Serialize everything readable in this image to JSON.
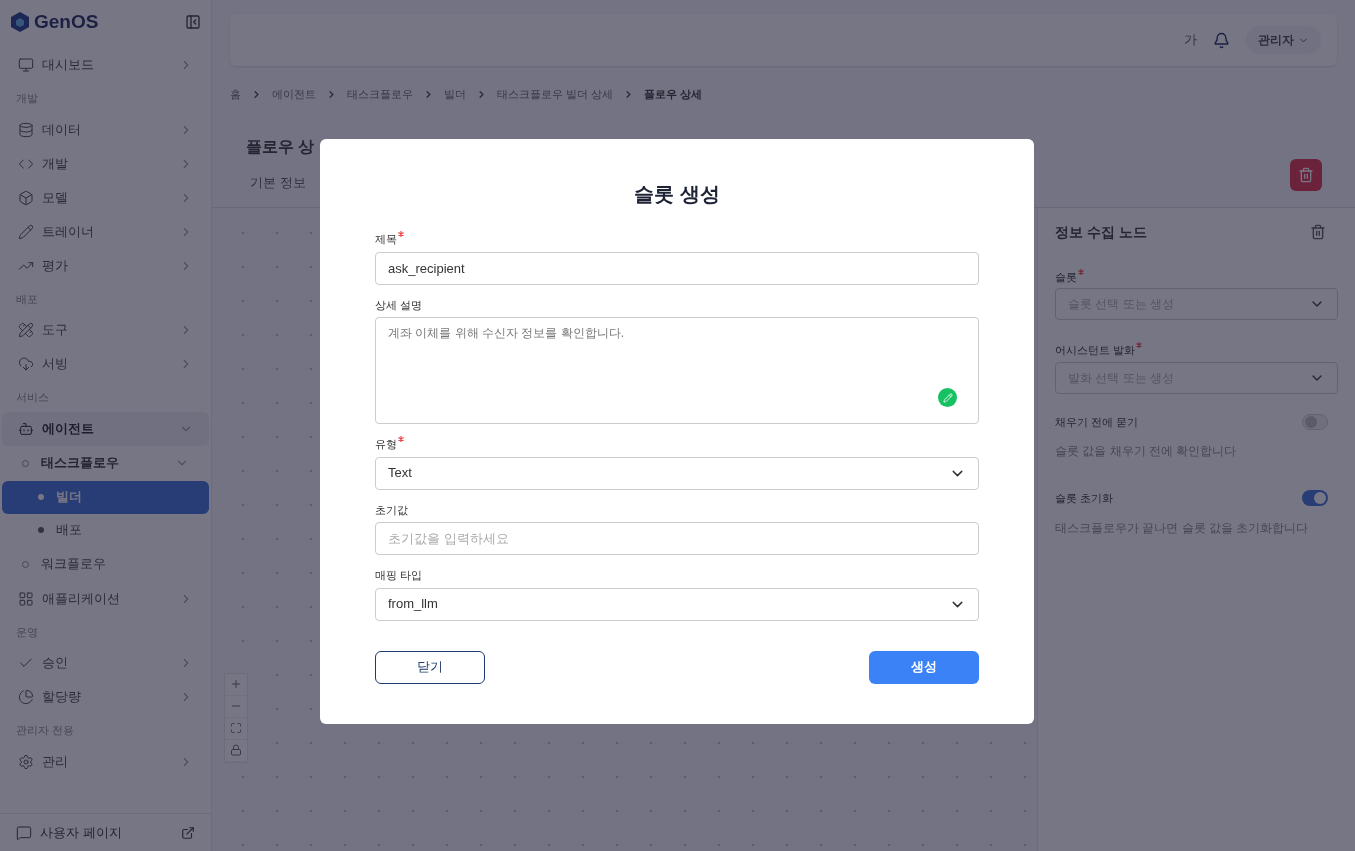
{
  "sidebar": {
    "logo": "GenOS",
    "sections": [
      {
        "items": [
          {
            "label": "대시보드",
            "selected": false,
            "expanded": false
          }
        ]
      },
      {
        "heading": "개발",
        "items": [
          {
            "label": "데이터",
            "selected": false,
            "expanded": false
          },
          {
            "label": "개발",
            "selected": false,
            "expanded": false
          },
          {
            "label": "모델",
            "selected": false,
            "expanded": false
          },
          {
            "label": "트레이너",
            "selected": false,
            "expanded": false
          },
          {
            "label": "평가",
            "selected": false,
            "expanded": false
          }
        ]
      },
      {
        "heading": "배포",
        "items": [
          {
            "label": "도구",
            "selected": false,
            "expanded": false
          },
          {
            "label": "서빙",
            "selected": false,
            "expanded": false
          }
        ]
      },
      {
        "heading": "서비스",
        "items": [
          {
            "label": "에이전트",
            "selected": false,
            "expanded": true,
            "children": [
              {
                "label": "태스크플로우",
                "selected": false,
                "expanded": true,
                "children": [
                  {
                    "label": "빌더",
                    "selected": true
                  },
                  {
                    "label": "배포",
                    "selected": false
                  }
                ]
              },
              {
                "label": "워크플로우",
                "selected": false,
                "expanded": false
              }
            ]
          },
          {
            "label": "애플리케이션",
            "selected": false,
            "expanded": false
          }
        ]
      },
      {
        "heading": "운영",
        "items": [
          {
            "label": "승인",
            "selected": false,
            "expanded": false
          },
          {
            "label": "할당량",
            "selected": false,
            "expanded": false
          }
        ]
      },
      {
        "heading": "관리자 전용",
        "items": [
          {
            "label": "관리",
            "selected": false,
            "expanded": false
          }
        ]
      }
    ],
    "footer": "사용자 페이지"
  },
  "topbar": {
    "font_button": "가",
    "user": "관리자"
  },
  "breadcrumb": [
    "홈",
    "에이전트",
    "태스크플로우",
    "빌더",
    "태스크플로우 빌더 상세",
    "플로우 상세"
  ],
  "page_title": "플로우 상",
  "tabs": [
    {
      "label": "기본 정보",
      "selected": false
    }
  ],
  "node_panel": {
    "title": "정보 수집 노드",
    "fields": [
      {
        "label": "슬롯",
        "required": true,
        "placeholder": "슬롯 선택 또는 생성"
      },
      {
        "label": "어시스턴트 발화",
        "required": true,
        "placeholder": "발화 선택 또는 생성"
      }
    ],
    "toggles": [
      {
        "label": "채우기 전에 묻기",
        "on": false,
        "description": "슬롯 값을 채우기 전에 확인합니다"
      },
      {
        "label": "슬롯 초기화",
        "on": true,
        "description": "태스크플로우가 끝나면 슬롯 값을 초기화합니다"
      }
    ]
  },
  "dialog": {
    "title": "슬롯 생성",
    "fields": [
      {
        "kind": "text",
        "label": "제목",
        "required": true,
        "value": "ask_recipient"
      },
      {
        "kind": "textarea",
        "label": "상세 설명",
        "required": false,
        "placeholder": "계좌 이체를 위해 수신자 정보를 확인합니다."
      },
      {
        "kind": "select",
        "label": "유형",
        "required": true,
        "value": "Text"
      },
      {
        "kind": "text",
        "label": "초기값",
        "required": false,
        "placeholder": "초기값을 입력하세요"
      },
      {
        "kind": "select",
        "label": "매핑 타입",
        "required": false,
        "value": "from_llm"
      }
    ],
    "cancel": "닫기",
    "submit": "생성"
  }
}
